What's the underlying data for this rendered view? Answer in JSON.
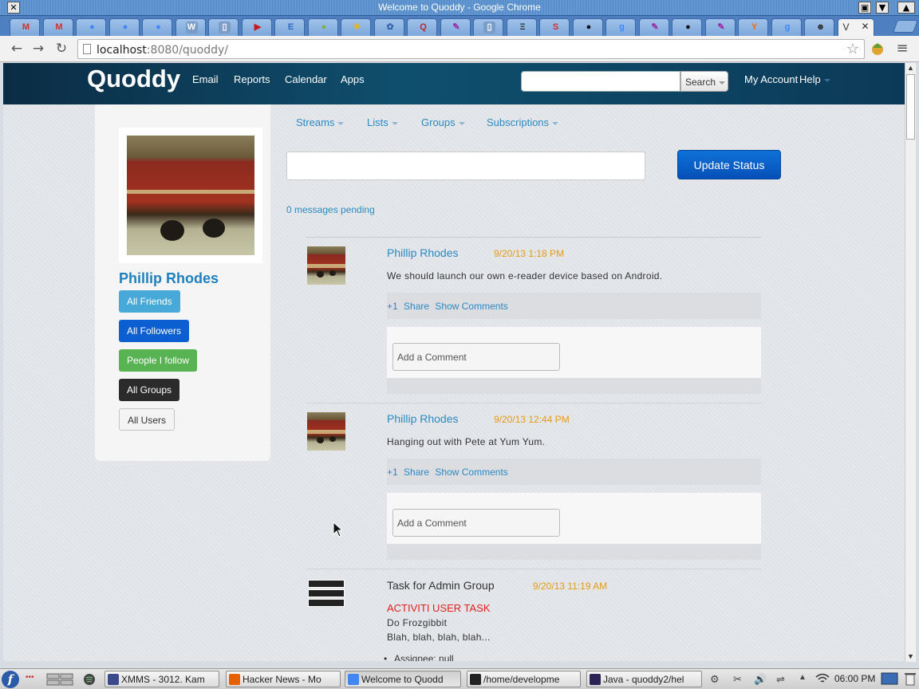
{
  "window": {
    "title": "Welcome to Quoddy - Google Chrome",
    "controls": {
      "close": "✕",
      "restore": "▣",
      "minimize": "▼",
      "maximize": "▲"
    }
  },
  "tabs": {
    "favicons": [
      {
        "icon": "gmail-icon",
        "glyph": "M",
        "color": "#d93025"
      },
      {
        "icon": "gmail-icon",
        "glyph": "M",
        "color": "#d93025"
      },
      {
        "icon": "google-maps-icon",
        "glyph": "●",
        "color": "#4285f4"
      },
      {
        "icon": "google-maps-icon",
        "glyph": "●",
        "color": "#4285f4"
      },
      {
        "icon": "google-maps-icon",
        "glyph": "●",
        "color": "#4285f4"
      },
      {
        "icon": "wikipedia-icon",
        "glyph": "W",
        "color": "#ffffff"
      },
      {
        "icon": "page-icon",
        "glyph": "▯",
        "color": "#ffffff"
      },
      {
        "icon": "youtube-icon",
        "glyph": "▶",
        "color": "#cc181e"
      },
      {
        "icon": "e-icon",
        "glyph": "E",
        "color": "#2a6ac4"
      },
      {
        "icon": "green-oval-icon",
        "glyph": "●",
        "color": "#7cb342"
      },
      {
        "icon": "pinwheel-icon",
        "glyph": "✳",
        "color": "#f4b400"
      },
      {
        "icon": "bug-icon",
        "glyph": "✿",
        "color": "#3366aa"
      },
      {
        "icon": "quora-icon",
        "glyph": "Q",
        "color": "#b92b27"
      },
      {
        "icon": "feather-icon",
        "glyph": "✎",
        "color": "#9b2ca6"
      },
      {
        "icon": "page-icon",
        "glyph": "▯",
        "color": "#ffffff"
      },
      {
        "icon": "evernote-icon",
        "glyph": "Ξ",
        "color": "#333333"
      },
      {
        "icon": "s-icon",
        "glyph": "S",
        "color": "#d32f2f"
      },
      {
        "icon": "github-icon",
        "glyph": "●",
        "color": "#111111"
      },
      {
        "icon": "google-icon",
        "glyph": "g",
        "color": "#4285f4"
      },
      {
        "icon": "feather-icon",
        "glyph": "✎",
        "color": "#9b2ca6"
      },
      {
        "icon": "github-icon",
        "glyph": "●",
        "color": "#111111"
      },
      {
        "icon": "feather-icon",
        "glyph": "✎",
        "color": "#9b2ca6"
      },
      {
        "icon": "hacker-news-icon",
        "glyph": "Y",
        "color": "#ff6600"
      },
      {
        "icon": "google-icon",
        "glyph": "g",
        "color": "#4285f4"
      },
      {
        "icon": "person-icon",
        "glyph": "☻",
        "color": "#333333"
      }
    ],
    "active": {
      "label": "V",
      "close": "✕"
    }
  },
  "toolbar": {
    "back": "←",
    "forward": "→",
    "reload": "↻",
    "url_host": "localhost",
    "url_rest": ":8080/quoddy/",
    "bookmark_star": "☆",
    "menu": "≡"
  },
  "navbar": {
    "brand": "Quoddy",
    "links": [
      "Email",
      "Reports",
      "Calendar",
      "Apps"
    ],
    "search_button": "Search",
    "my_account": "My Account",
    "help": "Help"
  },
  "profile": {
    "name": "Phillip Rhodes",
    "buttons": [
      {
        "label": "All Friends",
        "color": "#46a9d8"
      },
      {
        "label": "All Followers",
        "color": "#0c5fd0"
      },
      {
        "label": "People I follow",
        "color": "#58b352"
      },
      {
        "label": "All Groups",
        "color": "#2b2b2b"
      },
      {
        "label": "All Users",
        "color": "#f4f4f4"
      }
    ]
  },
  "subnav": [
    "Streams",
    "Lists",
    "Groups",
    "Subscriptions"
  ],
  "status": {
    "update_button": "Update Status",
    "pending": "0 messages pending"
  },
  "posts": [
    {
      "author": "Phillip Rhodes",
      "time": "9/20/13 1:18 PM",
      "message": "We should launch our own e-reader device based on Android.",
      "plus_one": "+1",
      "share": "Share",
      "show_comments": "Show Comments",
      "comment_placeholder": "Add a Comment"
    },
    {
      "author": "Phillip Rhodes",
      "time": "9/20/13 12:44 PM",
      "message": "Hanging out with Pete at Yum Yum.",
      "plus_one": "+1",
      "share": "Share",
      "show_comments": "Show Comments",
      "comment_placeholder": "Add a Comment"
    }
  ],
  "task": {
    "title": "Task for Admin Group",
    "time": "9/20/13 11:19 AM",
    "type": "ACTIVITI USER TASK",
    "name": "Do Frozgibbit",
    "description": "Blah, blah, blah, blah...",
    "assignee": "Assignee: null"
  },
  "taskbar": {
    "tasks": [
      {
        "label": "XMMS - 3012. Kam",
        "icon": "xmms-icon",
        "color": "#3a4a8a"
      },
      {
        "label": "Hacker News - Mo",
        "icon": "firefox-icon",
        "color": "#e66000"
      },
      {
        "label": "Welcome to Quodd",
        "icon": "chrome-icon",
        "color": "#4285f4"
      },
      {
        "label": "/home/developme",
        "icon": "terminal-icon",
        "color": "#222222"
      },
      {
        "label": "Java - quoddy2/hel",
        "icon": "eclipse-icon",
        "color": "#2c2255"
      }
    ],
    "clock": "06:00 PM"
  },
  "colors": {
    "accent": "#2a8ac4",
    "timestamp": "#e59b16",
    "task_type": "#e01f1f",
    "primary_button": "#0c5fd0"
  }
}
